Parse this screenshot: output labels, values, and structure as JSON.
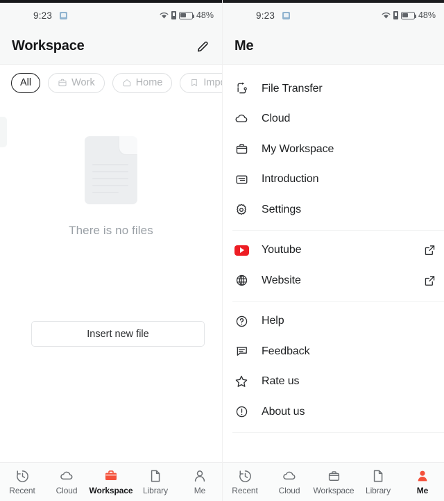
{
  "status_bar": {
    "time": "9:23",
    "app_icon": "app-notification-icon",
    "wifi_icon": "wifi-icon",
    "sim_icon": "sim-card-icon",
    "battery_icon": "battery-icon",
    "battery_percent": "48%"
  },
  "left_panel": {
    "header": {
      "title": "Workspace",
      "action_icon": "edit-pencil-icon"
    },
    "chips": [
      {
        "label": "All",
        "icon": null,
        "active": true
      },
      {
        "label": "Work",
        "icon": "briefcase-icon",
        "active": false
      },
      {
        "label": "Home",
        "icon": "home-icon",
        "active": false
      },
      {
        "label": "Import",
        "icon": "bookmark-icon",
        "active": false
      }
    ],
    "empty_state": {
      "illustration": "document-placeholder-icon",
      "message": "There is no files"
    },
    "insert_button": "Insert new file"
  },
  "right_panel": {
    "header": {
      "title": "Me"
    },
    "menu_groups": [
      {
        "items": [
          {
            "label": "File Transfer",
            "icon": "file-transfer-icon",
            "external": false
          },
          {
            "label": "Cloud",
            "icon": "cloud-icon",
            "external": false
          },
          {
            "label": "My Workspace",
            "icon": "briefcase-icon",
            "external": false
          },
          {
            "label": "Introduction",
            "icon": "article-icon",
            "external": false
          },
          {
            "label": "Settings",
            "icon": "gear-icon",
            "external": false
          }
        ]
      },
      {
        "items": [
          {
            "label": "Youtube",
            "icon": "youtube-icon",
            "external": true
          },
          {
            "label": "Website",
            "icon": "globe-icon",
            "external": true
          }
        ]
      },
      {
        "items": [
          {
            "label": "Help",
            "icon": "help-circle-icon",
            "external": false
          },
          {
            "label": "Feedback",
            "icon": "feedback-icon",
            "external": false
          },
          {
            "label": "Rate us",
            "icon": "star-icon",
            "external": false
          },
          {
            "label": "About us",
            "icon": "info-circle-icon",
            "external": false
          }
        ]
      }
    ]
  },
  "bottom_nav_left": {
    "items": [
      {
        "label": "Recent",
        "icon": "history-icon",
        "active": false
      },
      {
        "label": "Cloud",
        "icon": "cloud-icon",
        "active": false
      },
      {
        "label": "Workspace",
        "icon": "briefcase-icon",
        "active": true
      },
      {
        "label": "Library",
        "icon": "document-icon",
        "active": false
      },
      {
        "label": "Me",
        "icon": "person-icon",
        "active": false
      }
    ]
  },
  "bottom_nav_right": {
    "items": [
      {
        "label": "Recent",
        "icon": "history-icon",
        "active": false
      },
      {
        "label": "Cloud",
        "icon": "cloud-icon",
        "active": false
      },
      {
        "label": "Workspace",
        "icon": "briefcase-icon",
        "active": false
      },
      {
        "label": "Library",
        "icon": "document-icon",
        "active": false
      },
      {
        "label": "Me",
        "icon": "person-icon",
        "active": true
      }
    ]
  },
  "colors": {
    "accent_red": "#f4513b",
    "youtube_red": "#ed1d24",
    "text_primary": "#1e2022",
    "text_muted": "#9aa0a6",
    "header_bg": "#f7f8f8"
  }
}
